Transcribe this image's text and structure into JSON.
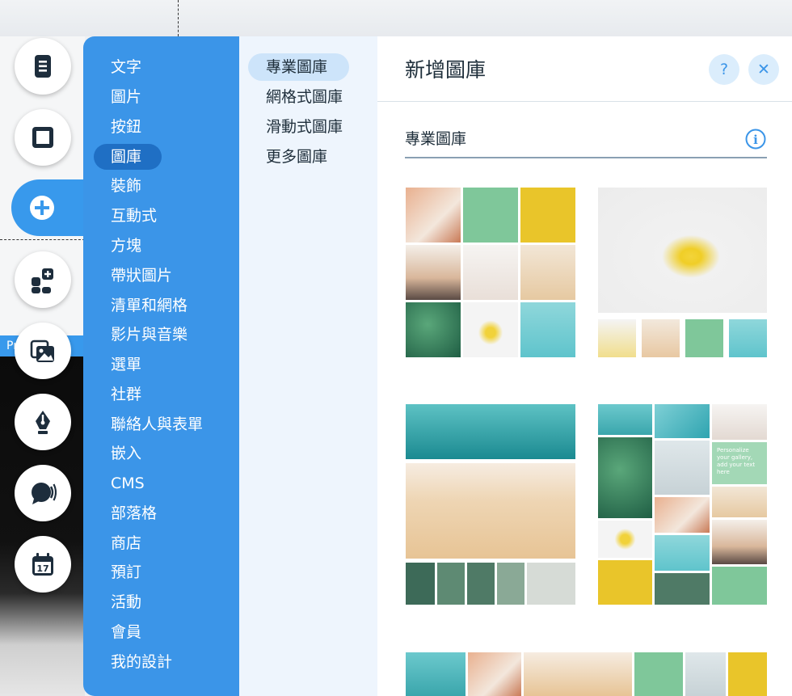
{
  "canvas": {
    "strip_label": "Pro Gallery"
  },
  "categories": [
    "文字",
    "圖片",
    "按鈕",
    "圖庫",
    "裝飾",
    "互動式",
    "方塊",
    "帶狀圖片",
    "清單和網格",
    "影片與音樂",
    "選單",
    "社群",
    "聯絡人與表單",
    "嵌入",
    "CMS",
    "部落格",
    "商店",
    "預訂",
    "活動",
    "會員",
    "我的設計"
  ],
  "selected_category": "圖庫",
  "subcategories": [
    "專業圖庫",
    "網格式圖庫",
    "滑動式圖庫",
    "更多圖庫"
  ],
  "selected_subcategory": "專業圖庫",
  "panel": {
    "title": "新增圖庫",
    "help_label": "?",
    "close_label": "✕",
    "section_title": "專業圖庫",
    "info_label": "i"
  },
  "gallery_thumb_2_caption": "Personalize your gallery, add your text here",
  "colors": {
    "accent": "#3899ec",
    "category_panel": "#3b95e8",
    "selected_pill": "#1f6fc4",
    "sub_panel": "#eef5fd"
  }
}
